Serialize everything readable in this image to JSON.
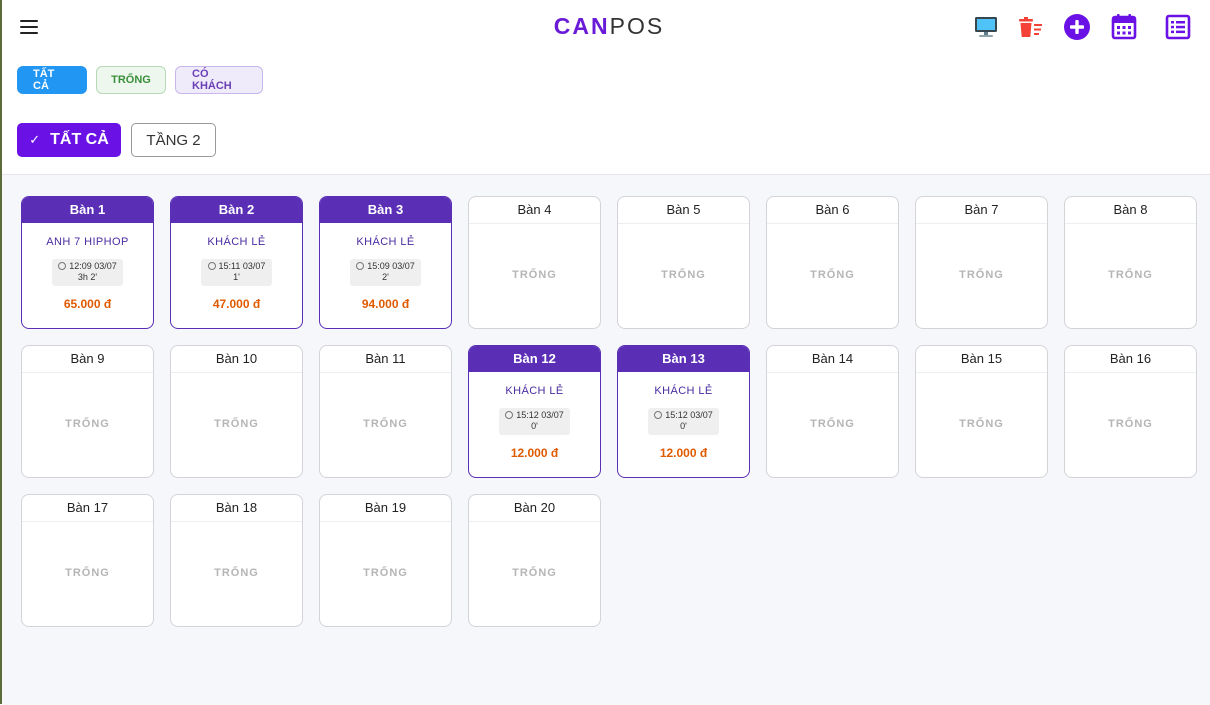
{
  "header": {
    "logo_part1": "CAN",
    "logo_part2": "POS",
    "icons": [
      "menu-icon",
      "monitor-icon",
      "trash-list-icon",
      "add-circle-icon",
      "calendar-icon",
      "list-icon"
    ]
  },
  "filters": {
    "all": "TẤT CẢ",
    "empty": "TRỐNG",
    "occupied": "CÓ KHÁCH"
  },
  "floors": {
    "check": "✓",
    "all": "TẤT CẢ",
    "floor2": "TẦNG 2"
  },
  "colors": {
    "accent": "#6a11e6",
    "occupied": "#5a2fb6",
    "amount": "#e05a00",
    "filter_all": "#2196f3"
  },
  "tables": [
    {
      "name": "Bàn 1",
      "occupied": true,
      "guest": "ANH 7 HIPHOP",
      "time": "12:09 03/07",
      "duration": "3h 2'",
      "amount": "65.000 đ"
    },
    {
      "name": "Bàn 2",
      "occupied": true,
      "guest": "KHÁCH LẺ",
      "time": "15:11 03/07",
      "duration": "1'",
      "amount": "47.000 đ"
    },
    {
      "name": "Bàn 3",
      "occupied": true,
      "guest": "KHÁCH LẺ",
      "time": "15:09 03/07",
      "duration": "2'",
      "amount": "94.000 đ"
    },
    {
      "name": "Bàn 4",
      "occupied": false,
      "status": "TRỐNG"
    },
    {
      "name": "Bàn 5",
      "occupied": false,
      "status": "TRỐNG"
    },
    {
      "name": "Bàn 6",
      "occupied": false,
      "status": "TRỐNG"
    },
    {
      "name": "Bàn 7",
      "occupied": false,
      "status": "TRỐNG"
    },
    {
      "name": "Bàn 8",
      "occupied": false,
      "status": "TRỐNG"
    },
    {
      "name": "Bàn 9",
      "occupied": false,
      "status": "TRỐNG"
    },
    {
      "name": "Bàn 10",
      "occupied": false,
      "status": "TRỐNG"
    },
    {
      "name": "Bàn 11",
      "occupied": false,
      "status": "TRỐNG"
    },
    {
      "name": "Bàn 12",
      "occupied": true,
      "guest": "KHÁCH LẺ",
      "time": "15:12 03/07",
      "duration": "0'",
      "amount": "12.000 đ"
    },
    {
      "name": "Bàn 13",
      "occupied": true,
      "guest": "KHÁCH LẺ",
      "time": "15:12 03/07",
      "duration": "0'",
      "amount": "12.000 đ"
    },
    {
      "name": "Bàn 14",
      "occupied": false,
      "status": "TRỐNG"
    },
    {
      "name": "Bàn 15",
      "occupied": false,
      "status": "TRỐNG"
    },
    {
      "name": "Bàn 16",
      "occupied": false,
      "status": "TRỐNG"
    },
    {
      "name": "Bàn 17",
      "occupied": false,
      "status": "TRỐNG"
    },
    {
      "name": "Bàn 18",
      "occupied": false,
      "status": "TRỐNG"
    },
    {
      "name": "Bàn 19",
      "occupied": false,
      "status": "TRỐNG"
    },
    {
      "name": "Bàn 20",
      "occupied": false,
      "status": "TRỐNG"
    }
  ]
}
